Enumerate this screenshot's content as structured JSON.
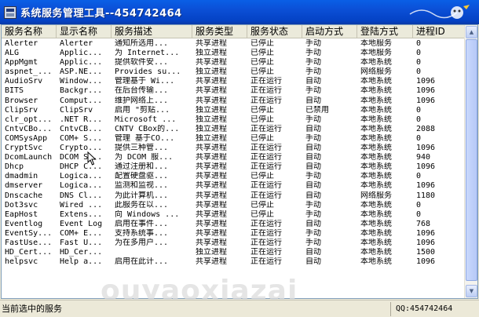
{
  "window": {
    "title": "系统服务管理工具--454742464"
  },
  "columns": [
    "服务名称",
    "显示名称",
    "服务描述",
    "服务类型",
    "服务状态",
    "启动方式",
    "登陆方式",
    "进程ID"
  ],
  "rows": [
    [
      "Alerter",
      "Alerter",
      "通知所选用...",
      "共享进程",
      "已停止",
      "手动",
      "本地服务",
      "0"
    ],
    [
      "ALG",
      "Applic...",
      "为 Internet...",
      "独立进程",
      "已停止",
      "手动",
      "本地服务",
      "0"
    ],
    [
      "AppMgmt",
      "Applic...",
      "提供软件安...",
      "共享进程",
      "已停止",
      "手动",
      "本地系统",
      "0"
    ],
    [
      "aspnet_...",
      "ASP.NE...",
      "Provides su...",
      "独立进程",
      "已停止",
      "手动",
      "网络服务",
      "0"
    ],
    [
      "AudioSrv",
      "Window...",
      "管理基于 Wi...",
      "共享进程",
      "正在运行",
      "自动",
      "本地系统",
      "1096"
    ],
    [
      "BITS",
      "Backgr...",
      "在后台传输...",
      "共享进程",
      "正在运行",
      "手动",
      "本地系统",
      "1096"
    ],
    [
      "Browser",
      "Comput...",
      "维护网络上...",
      "共享进程",
      "正在运行",
      "自动",
      "本地系统",
      "1096"
    ],
    [
      "ClipSrv",
      "ClipSrv",
      "启用 \"剪贴...",
      "独立进程",
      "已停止",
      "已禁用",
      "本地系统",
      "0"
    ],
    [
      "clr_opt...",
      ".NET R...",
      "Microsoft ...",
      "独立进程",
      "已停止",
      "手动",
      "本地系统",
      "0"
    ],
    [
      "CntvCBo...",
      "CntvCB...",
      "CNTV CBox的...",
      "独立进程",
      "正在运行",
      "自动",
      "本地系统",
      "2088"
    ],
    [
      "COMSysApp",
      "COM+ S...",
      "管理 基于CO...",
      "独立进程",
      "已停止",
      "手动",
      "本地系统",
      "0"
    ],
    [
      "CryptSvc",
      "Crypto...",
      "提供三种管...",
      "共享进程",
      "正在运行",
      "自动",
      "本地系统",
      "1096"
    ],
    [
      "DcomLaunch",
      "DCOM S...",
      "为 DCOM 服...",
      "共享进程",
      "正在运行",
      "自动",
      "本地系统",
      "940"
    ],
    [
      "Dhcp",
      "DHCP C...",
      "通过注册和...",
      "共享进程",
      "正在运行",
      "自动",
      "本地系统",
      "1096"
    ],
    [
      "dmadmin",
      "Logica...",
      "配置硬盘驱...",
      "共享进程",
      "已停止",
      "手动",
      "本地系统",
      "0"
    ],
    [
      "dmserver",
      "Logica...",
      "监测和监视...",
      "共享进程",
      "正在运行",
      "自动",
      "本地系统",
      "1096"
    ],
    [
      "Dnscache",
      "DNS Cl...",
      "为此计算机...",
      "共享进程",
      "正在运行",
      "自动",
      "网络服务",
      "1180"
    ],
    [
      "Dot3svc",
      "Wired ...",
      "此服务在以...",
      "共享进程",
      "已停止",
      "手动",
      "本地系统",
      "0"
    ],
    [
      "EapHost",
      "Extens...",
      "向 Windows ...",
      "共享进程",
      "已停止",
      "手动",
      "本地系统",
      "0"
    ],
    [
      "Eventlog",
      "Event Log",
      "启用在事件...",
      "共享进程",
      "正在运行",
      "自动",
      "本地系统",
      "768"
    ],
    [
      "EventSy...",
      "COM+ E...",
      "支持系统事...",
      "共享进程",
      "正在运行",
      "手动",
      "本地系统",
      "1096"
    ],
    [
      "FastUse...",
      "Fast U...",
      "为在多用户...",
      "共享进程",
      "正在运行",
      "手动",
      "本地系统",
      "1096"
    ],
    [
      "HD_Cert...",
      "HD_Cer...",
      "",
      "独立进程",
      "正在运行",
      "自动",
      "本地系统",
      "1500"
    ],
    [
      "helpsvc",
      "Help a...",
      "启用在此计...",
      "共享进程",
      "正在运行",
      "自动",
      "本地系统",
      "1096"
    ]
  ],
  "watermark": "ouyaoxiazai",
  "statusbar": {
    "left": "当前选中的服务",
    "right": "QQ:454742464"
  },
  "colors": {
    "titlebar": "#0b4fd6",
    "header_bg": "#ebeadb",
    "list_bg": "#ffffff"
  },
  "icons": {
    "app": "app-window-icon",
    "decor": "mascot-decoration-icon",
    "cursor": "mouse-pointer-icon"
  }
}
